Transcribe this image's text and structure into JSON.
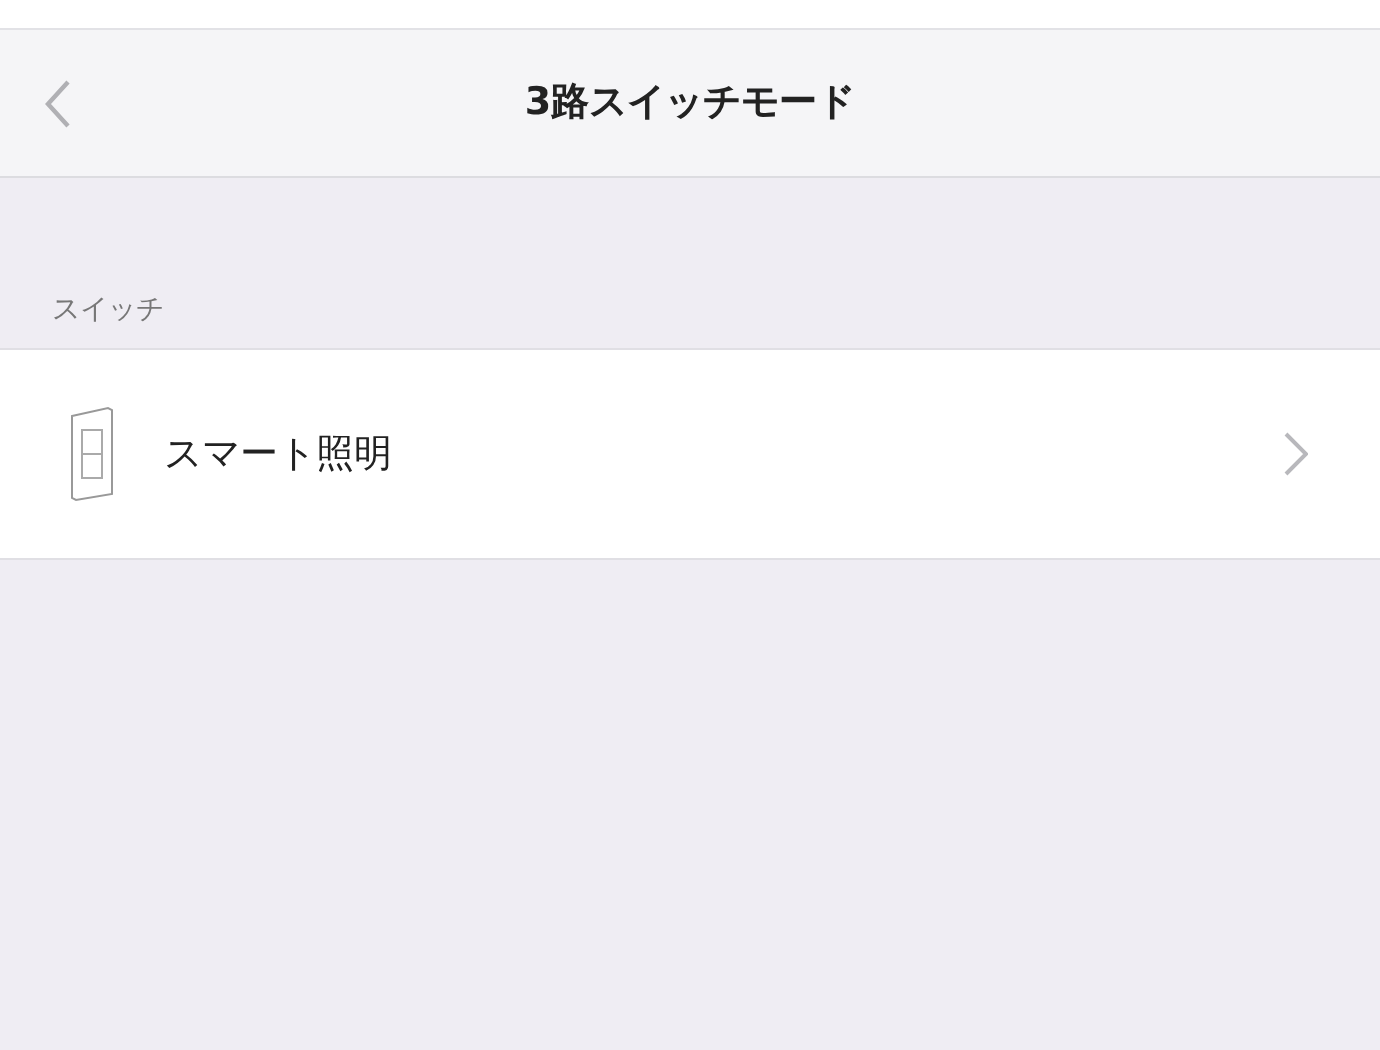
{
  "navigation_bar": {
    "title": "3路スイッチモード"
  },
  "sections": [
    {
      "header": "スイッチ",
      "items": [
        {
          "label": "スマート照明"
        }
      ]
    }
  ]
}
